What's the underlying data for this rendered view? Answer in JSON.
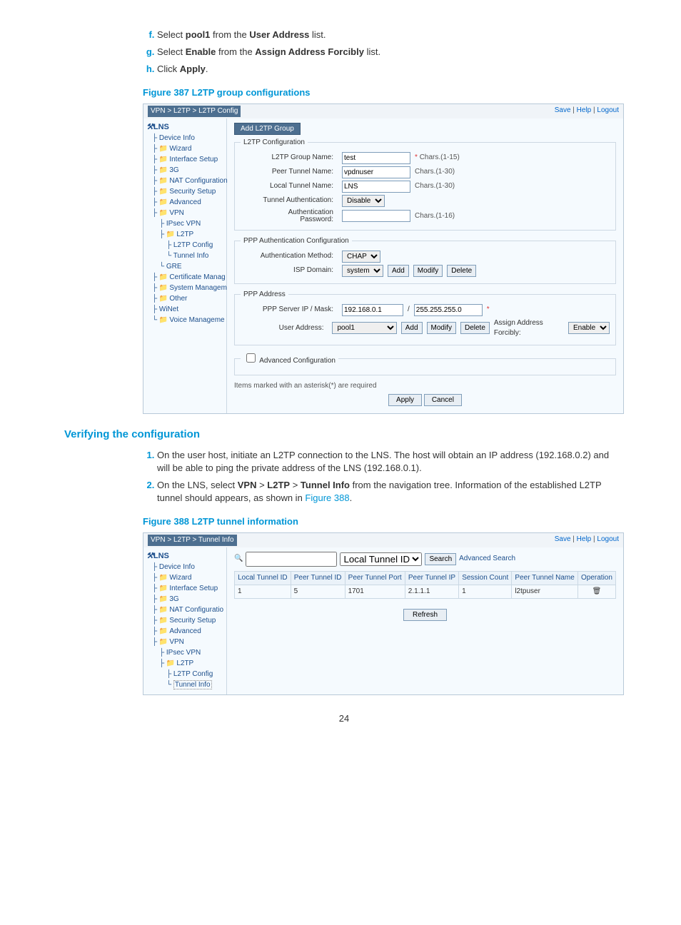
{
  "instructions1": [
    {
      "prefix": "Select ",
      "b1": "pool1",
      "mid": " from the ",
      "b2": "User Address",
      "suffix": " list."
    },
    {
      "prefix": "Select ",
      "b1": "Enable",
      "mid": " from the ",
      "b2": "Assign Address Forcibly",
      "suffix": " list."
    },
    {
      "prefix": "Click ",
      "b1": "Apply",
      "mid": "",
      "b2": "",
      "suffix": "."
    }
  ],
  "fig1_cap": "Figure 387 L2TP group configurations",
  "shot1": {
    "crumb": "VPN > L2TP > L2TP Config",
    "links": {
      "save": "Save",
      "help": "Help",
      "logout": "Logout"
    },
    "lns": "LNS",
    "nav": {
      "device": "Device Info",
      "wizard": "Wizard",
      "ifsetup": "Interface Setup",
      "g3": "3G",
      "nat": "NAT Configuration",
      "sec": "Security Setup",
      "adv": "Advanced",
      "vpn": "VPN",
      "ipsec": "IPsec VPN",
      "l2tp": "L2TP",
      "l2tpc": "L2TP Config",
      "tinfo": "Tunnel Info",
      "gre": "GRE",
      "cert": "Certificate Manag",
      "sys": "System Managem",
      "other": "Other",
      "winet": "WiNet",
      "voice": "Voice Manageme"
    },
    "addbtn": "Add L2TP Group",
    "legend_cfg": "L2TP Configuration",
    "lbl_group": "L2TP Group Name:",
    "val_group": "test",
    "hint_group": "Chars.(1-15)",
    "lbl_peer": "Peer Tunnel Name:",
    "val_peer": "vpdnuser",
    "hint_peer": "Chars.(1-30)",
    "lbl_local": "Local Tunnel Name:",
    "val_local": "LNS",
    "hint_local": "Chars.(1-30)",
    "lbl_auth": "Tunnel Authentication:",
    "val_auth": "Disable",
    "lbl_pw": "Authentication\nPassword:",
    "hint_pw": "Chars.(1-16)",
    "legend_ppp": "PPP Authentication Configuration",
    "lbl_method": "Authentication Method:",
    "val_method": "CHAP",
    "lbl_domain": "ISP Domain:",
    "val_domain": "system",
    "add": "Add",
    "modify": "Modify",
    "delete": "Delete",
    "legend_addr": "PPP Address",
    "lbl_srv": "PPP Server IP / Mask:",
    "val_srvip": "192.168.0.1",
    "val_srvmask": "255.255.255.0",
    "lbl_user": "User Address:",
    "val_user": "pool1",
    "assign": "Assign Address Forcibly:",
    "val_assign": "Enable",
    "advcfg": "Advanced Configuration",
    "req": "Items marked with an asterisk(*) are required",
    "apply": "Apply",
    "cancel": "Cancel"
  },
  "verify_title": "Verifying the configuration",
  "verify_steps": [
    "On the user host, initiate an L2TP connection to the LNS. The host will obtain an IP address (192.168.0.2) and will be able to ping the private address of the LNS (192.168.0.1).",
    "On the LNS, select VPN > L2TP > Tunnel Info from the navigation tree. Information of the established L2TP tunnel should appears, as shown in Figure 388."
  ],
  "fig2_cap": "Figure 388 L2TP tunnel information",
  "shot2": {
    "crumb": "VPN > L2TP > Tunnel Info",
    "search_field": "Local Tunnel ID",
    "search": "Search",
    "adv": "Advanced Search",
    "cols": [
      "Local Tunnel ID",
      "Peer Tunnel ID",
      "Peer Tunnel Port",
      "Peer Tunnel IP",
      "Session Count",
      "Peer Tunnel Name",
      "Operation"
    ],
    "row": [
      "1",
      "5",
      "1701",
      "2.1.1.1",
      "1",
      "l2tpuser",
      "🗑"
    ],
    "refresh": "Refresh"
  },
  "pagenum": "24"
}
